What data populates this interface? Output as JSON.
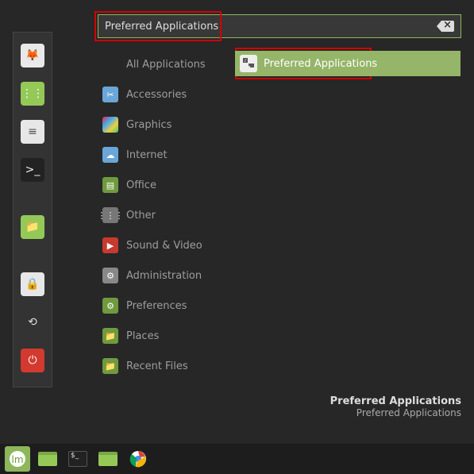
{
  "search": {
    "value": "Preferred Applications"
  },
  "favorites": [
    {
      "name": "firefox-icon",
      "bg": "#e9e9e9",
      "fg": "#e2682b",
      "glyph": "🦊"
    },
    {
      "name": "apps-icon",
      "bg": "#94c958",
      "fg": "#fff",
      "glyph": "⋮⋮"
    },
    {
      "name": "settings-icon",
      "bg": "#e7e7e7",
      "fg": "#555",
      "glyph": "≡"
    },
    {
      "name": "terminal-icon",
      "bg": "#222",
      "fg": "#eee",
      "glyph": ">_"
    },
    {
      "name": "files-icon",
      "bg": "#94c958",
      "fg": "#6f9a3e",
      "glyph": "📁",
      "gapBefore": true
    },
    {
      "name": "lock-icon",
      "bg": "#e7e7e7",
      "fg": "#333",
      "glyph": "🔒",
      "gapBefore": true
    },
    {
      "name": "logout-icon",
      "bg": "#333",
      "fg": "#ddd",
      "glyph": "⟲"
    },
    {
      "name": "power-icon",
      "bg": "#d23a2f",
      "fg": "#fff",
      "glyph": "⏻",
      "spacerBefore": true
    }
  ],
  "categories": [
    {
      "label": "All Applications",
      "icon": "all-apps-icon",
      "bg": "transparent",
      "glyph": ""
    },
    {
      "label": "Accessories",
      "icon": "scissors-icon",
      "bg": "#6aa6d8",
      "glyph": "✂"
    },
    {
      "label": "Graphics",
      "icon": "palette-icon",
      "bg": "linear-gradient(135deg,#e24,#4ae,#ec4,#4c6)",
      "glyph": ""
    },
    {
      "label": "Internet",
      "icon": "globe-icon",
      "bg": "#6aa6d8",
      "glyph": "☁"
    },
    {
      "label": "Office",
      "icon": "office-icon",
      "bg": "#6f9a3e",
      "glyph": "▤"
    },
    {
      "label": "Other",
      "icon": "grid-icon",
      "bg": "#777",
      "glyph": "⋮⋮⋮"
    },
    {
      "label": "Sound & Video",
      "icon": "play-icon",
      "bg": "#c73a2f",
      "glyph": "▶"
    },
    {
      "label": "Administration",
      "icon": "admin-icon",
      "bg": "#888",
      "glyph": "⚙"
    },
    {
      "label": "Preferences",
      "icon": "prefs-icon",
      "bg": "#6f9a3e",
      "glyph": "⚙"
    },
    {
      "label": "Places",
      "icon": "folder-icon",
      "bg": "#6f9a3e",
      "glyph": "📁"
    },
    {
      "label": "Recent Files",
      "icon": "recent-icon",
      "bg": "#6f9a3e",
      "glyph": "📁"
    }
  ],
  "result": {
    "label": "Preferred Applications"
  },
  "description": {
    "title": "Preferred Applications",
    "subtitle": "Preferred Applications"
  },
  "taskbar": [
    {
      "name": "menu-button",
      "active": true,
      "bg": "#fff",
      "html": "<svg width='22' height='22'><circle cx='11' cy='11' r='10' fill='#fff'/><text x='11' y='16' text-anchor='middle' font-size='12' fill='#6f9a3e'>lm</text></svg>"
    },
    {
      "name": "files-launcher",
      "active": false,
      "bg": "#94c958",
      "html": "<div style='width:24px;height:18px;background:#94c958;border-radius:2px;border-top:4px solid #7aa846'></div>"
    },
    {
      "name": "terminal-launcher",
      "active": false,
      "bg": "#222",
      "html": "<div style='width:24px;height:20px;background:#222;border:1px solid #555;border-radius:2px;color:#ddd;font-size:9px;line-height:10px;padding-left:2px'>$_</div>"
    },
    {
      "name": "files-launcher-2",
      "active": false,
      "bg": "#94c958",
      "html": "<div style='width:24px;height:18px;background:#94c958;border-radius:2px;border-top:4px solid #7aa846'></div>"
    },
    {
      "name": "chrome-launcher",
      "active": false,
      "bg": "#fff",
      "html": "<svg width='22' height='22'><circle cx='11' cy='11' r='10' fill='#fff'/><circle cx='11' cy='11' r='4' fill='#4a8af4'/><path d='M11 1 A10 10 0 0 1 20 8 L13 9 Z' fill='#db4437'/><path d='M20 8 A10 10 0 0 1 8 21 L10 14 Z' fill='#f4b400'/><path d='M8 21 A10 10 0 0 1 3 5 L9 10 Z' fill='#0f9d58'/></svg>"
    }
  ]
}
